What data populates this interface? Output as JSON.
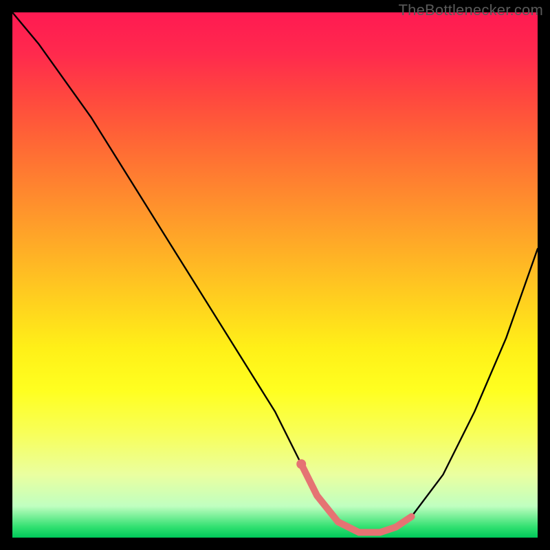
{
  "watermark": {
    "text": "TheBottlenecker.com"
  },
  "chart_data": {
    "type": "line",
    "title": "",
    "xlabel": "",
    "ylabel": "",
    "xlim": [
      0,
      100
    ],
    "ylim": [
      0,
      100
    ],
    "series": [
      {
        "name": "bottleneck-curve",
        "x": [
          0,
          5,
          10,
          15,
          20,
          25,
          30,
          35,
          40,
          45,
          50,
          55,
          58,
          62,
          66,
          70,
          73,
          76,
          82,
          88,
          94,
          100
        ],
        "values": [
          100,
          94,
          87,
          80,
          72,
          64,
          56,
          48,
          40,
          32,
          24,
          14,
          8,
          3,
          1,
          1,
          2,
          4,
          12,
          24,
          38,
          55
        ],
        "color": "#000000"
      }
    ],
    "highlight_segment": {
      "color": "#e57373",
      "x": [
        55,
        58,
        62,
        66,
        70,
        73,
        76
      ],
      "values": [
        14,
        8,
        3,
        1,
        1,
        2,
        4
      ]
    },
    "highlight_dot": {
      "x": 55,
      "y": 14,
      "color": "#e57373"
    },
    "background_gradient": {
      "top": "#ff1a52",
      "mid": "#fff018",
      "bottom": "#00c85a"
    }
  }
}
